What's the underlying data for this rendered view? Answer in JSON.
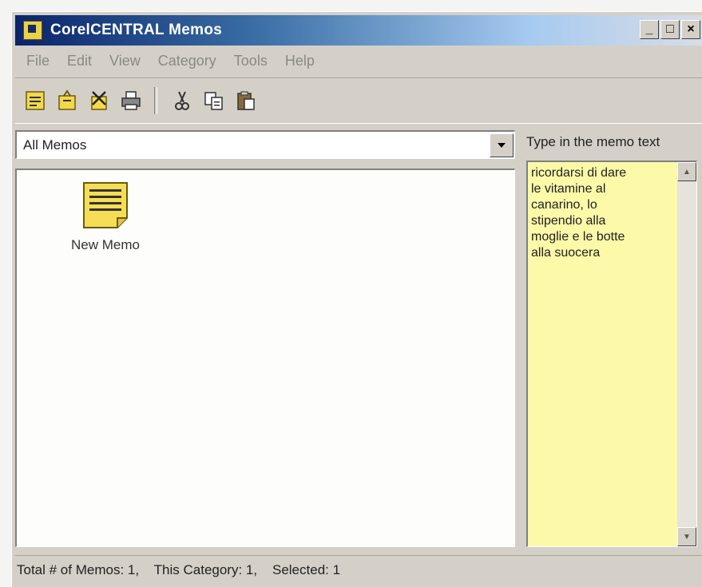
{
  "window": {
    "title": "CorelCENTRAL Memos",
    "controls": {
      "minimize": "_",
      "maximize": "□",
      "close": "×"
    }
  },
  "menu": [
    "File",
    "Edit",
    "View",
    "Category",
    "Tools",
    "Help"
  ],
  "toolbar": {
    "buttons": [
      "new-memo-icon",
      "open-icon",
      "delete-icon",
      "print-icon",
      "cut-icon",
      "copy-icon",
      "paste-icon"
    ]
  },
  "category": {
    "selected": "All Memos"
  },
  "memos": [
    {
      "label": "New Memo"
    }
  ],
  "editor": {
    "hint": "Type in the memo text",
    "text": "ricordarsi di dare\nle vitamine al\ncanarino, lo\nstipendio alla\nmoglie e le botte\nalla suocera"
  },
  "status": {
    "text": "Total # of Memos: 1,    This Category: 1,    Selected: 1"
  },
  "colors": {
    "memo_background": "#fcf9a8",
    "titlebar_start": "#0a246a"
  }
}
